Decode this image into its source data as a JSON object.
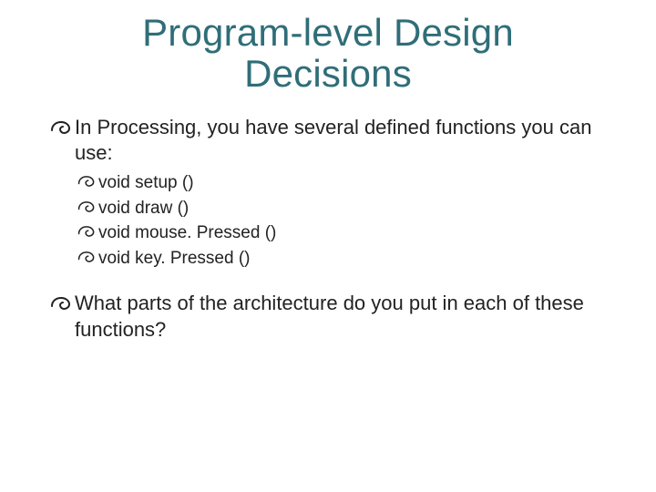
{
  "title": "Program-level Design Decisions",
  "bullets": {
    "intro": "In Processing, you have several defined functions you can use:",
    "items": [
      "void setup ()",
      "void draw ()",
      "void mouse. Pressed ()",
      "void key. Pressed ()"
    ],
    "closing": "What parts of the architecture do you put in each of these functions?"
  },
  "bullet_icon": "swirl-icon",
  "colors": {
    "title": "#2F6E78",
    "body": "#222222",
    "bullet": "#222222"
  }
}
